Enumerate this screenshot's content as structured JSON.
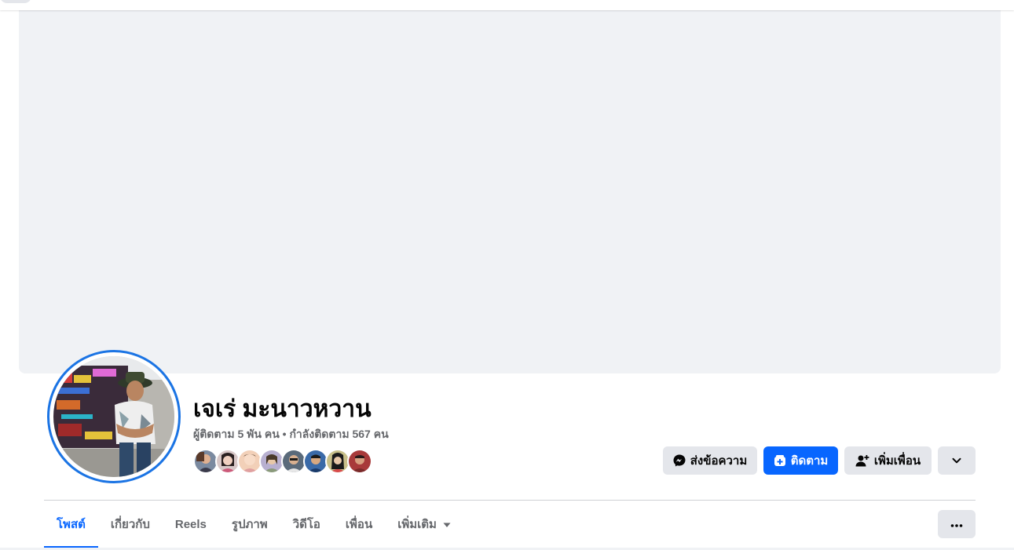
{
  "profile": {
    "name": "เจเร่ มะนาวหวาน",
    "followers_text": "ผู้ติดตาม 5 พัน คน",
    "separator": "•",
    "following_text": "กำลังติดตาม 567 คน"
  },
  "actions": {
    "message_label": "ส่งข้อความ",
    "follow_label": "ติดตาม",
    "add_friend_label": "เพิ่มเพื่อน"
  },
  "tabs": [
    {
      "label": "โพสต์",
      "active": true
    },
    {
      "label": "เกี่ยวกับ",
      "active": false
    },
    {
      "label": "Reels",
      "active": false
    },
    {
      "label": "รูปภาพ",
      "active": false
    },
    {
      "label": "วิดีโอ",
      "active": false
    },
    {
      "label": "เพื่อน",
      "active": false
    },
    {
      "label": "เพิ่มเติม",
      "active": false
    }
  ],
  "colors": {
    "accent": "#0866ff",
    "avatar_ring": "#1b74e4",
    "button_grey": "#e4e6eb",
    "cover_bg": "#f0f2f5",
    "secondary_text": "#65676b"
  },
  "icons": {
    "message": "messenger-icon",
    "follow": "follow-icon",
    "add_friend": "add-friend-icon",
    "dropdown": "chevron-down-icon",
    "more": "more-icon",
    "tab_more": "caret-down-icon"
  }
}
